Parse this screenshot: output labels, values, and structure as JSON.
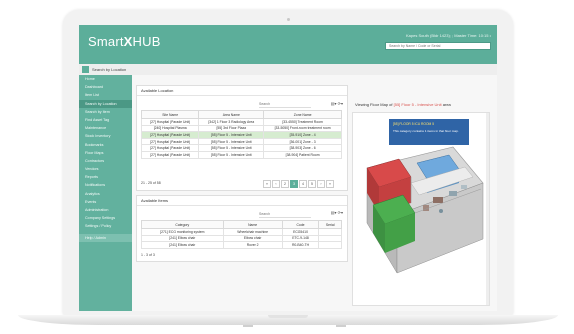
{
  "app": {
    "logo_pre": "Smart",
    "logo_x": "X",
    "logo_post": "HUB",
    "user_line": "Kapes South (Bldr 1423); ; Master Time: 10:15 •",
    "search_placeholder": "Search by Name / Code or Serial"
  },
  "breadcrumb": "Search by Location",
  "sidebar": {
    "items": [
      {
        "label": "Home"
      },
      {
        "label": "Dashboard"
      },
      {
        "label": "Item List"
      },
      {
        "label": "Search by Location",
        "active": true
      },
      {
        "label": "Search by Item"
      },
      {
        "label": "Find Asset Tag"
      },
      {
        "label": "Maintenance"
      },
      {
        "label": "Stock Inventory"
      },
      {
        "label": "Bookmarks"
      },
      {
        "label": "Floor Maps"
      },
      {
        "label": "Contractors"
      },
      {
        "label": "Vendors"
      },
      {
        "label": "Reports"
      },
      {
        "label": "Notifications"
      },
      {
        "label": "Analytics"
      },
      {
        "label": "Events"
      },
      {
        "label": "Administration"
      },
      {
        "label": "Company Settings"
      },
      {
        "label": "Settings / Policy"
      }
    ],
    "footer": "Help / Admin"
  },
  "locations": {
    "title": "Available Location",
    "search_placeholder": "Search",
    "columns": [
      "Site Name",
      "Area Name",
      "Zone Name"
    ],
    "rows": [
      [
        "[27] Hospital (Parade Unit)",
        "[342] 1 Floor 3 Radiology Area",
        "[33-4550] Treatment Room"
      ],
      [
        "[240] Hospital Plasma",
        "[55] 3rd Floor Plaza",
        "[33-5050] Front-room treatment room"
      ],
      [
        "[27] Hospital (Parade Unit)",
        "[55] Floor 5 - Intensive Unit",
        "[35-910] Zone - 4"
      ],
      [
        "[27] Hospital (Parade Unit)",
        "[55] Floor 5 - Intensive Unit",
        "[36-001] Zone - 3"
      ],
      [
        "[27] Hospital (Parade Unit)",
        "[55] Floor 5 - Intensive Unit",
        "[38-903] Zone - 6"
      ],
      [
        "[27] Hospital (Parade Unit)",
        "[55] Floor 5 - Intensive Unit",
        "[38-904] Patient Room"
      ]
    ],
    "highlighted_row": 2,
    "count": "21 - 25 of 58",
    "pages": [
      "«",
      "‹",
      "2",
      "3",
      "4",
      "5",
      "›",
      "»"
    ],
    "current_page": "3"
  },
  "items": {
    "title": "Available Items",
    "search_placeholder": "Search",
    "columns": [
      "Category",
      "Name",
      "Code",
      "Serial"
    ],
    "rows": [
      [
        "[271] ECG monitoring system",
        "Wheelchair machine",
        "ECG5410",
        ""
      ],
      [
        "[241] Elbow chair",
        "Elbow chair",
        "ETC-9-148",
        ""
      ],
      [
        "[241] Elbow chair",
        "Rover 2",
        "R0-B40-TH",
        ""
      ]
    ],
    "count": "1 - 3 of 3"
  },
  "map": {
    "view_prefix": "Viewing Floor Map of ",
    "view_highlight": "[55] Floor 5 - Intensive Unit",
    "view_suffix": " area",
    "info_title": "[55] FLOOR 5 ICU ROOM 5",
    "info_text": "This category contains 1 items in that floor map."
  }
}
